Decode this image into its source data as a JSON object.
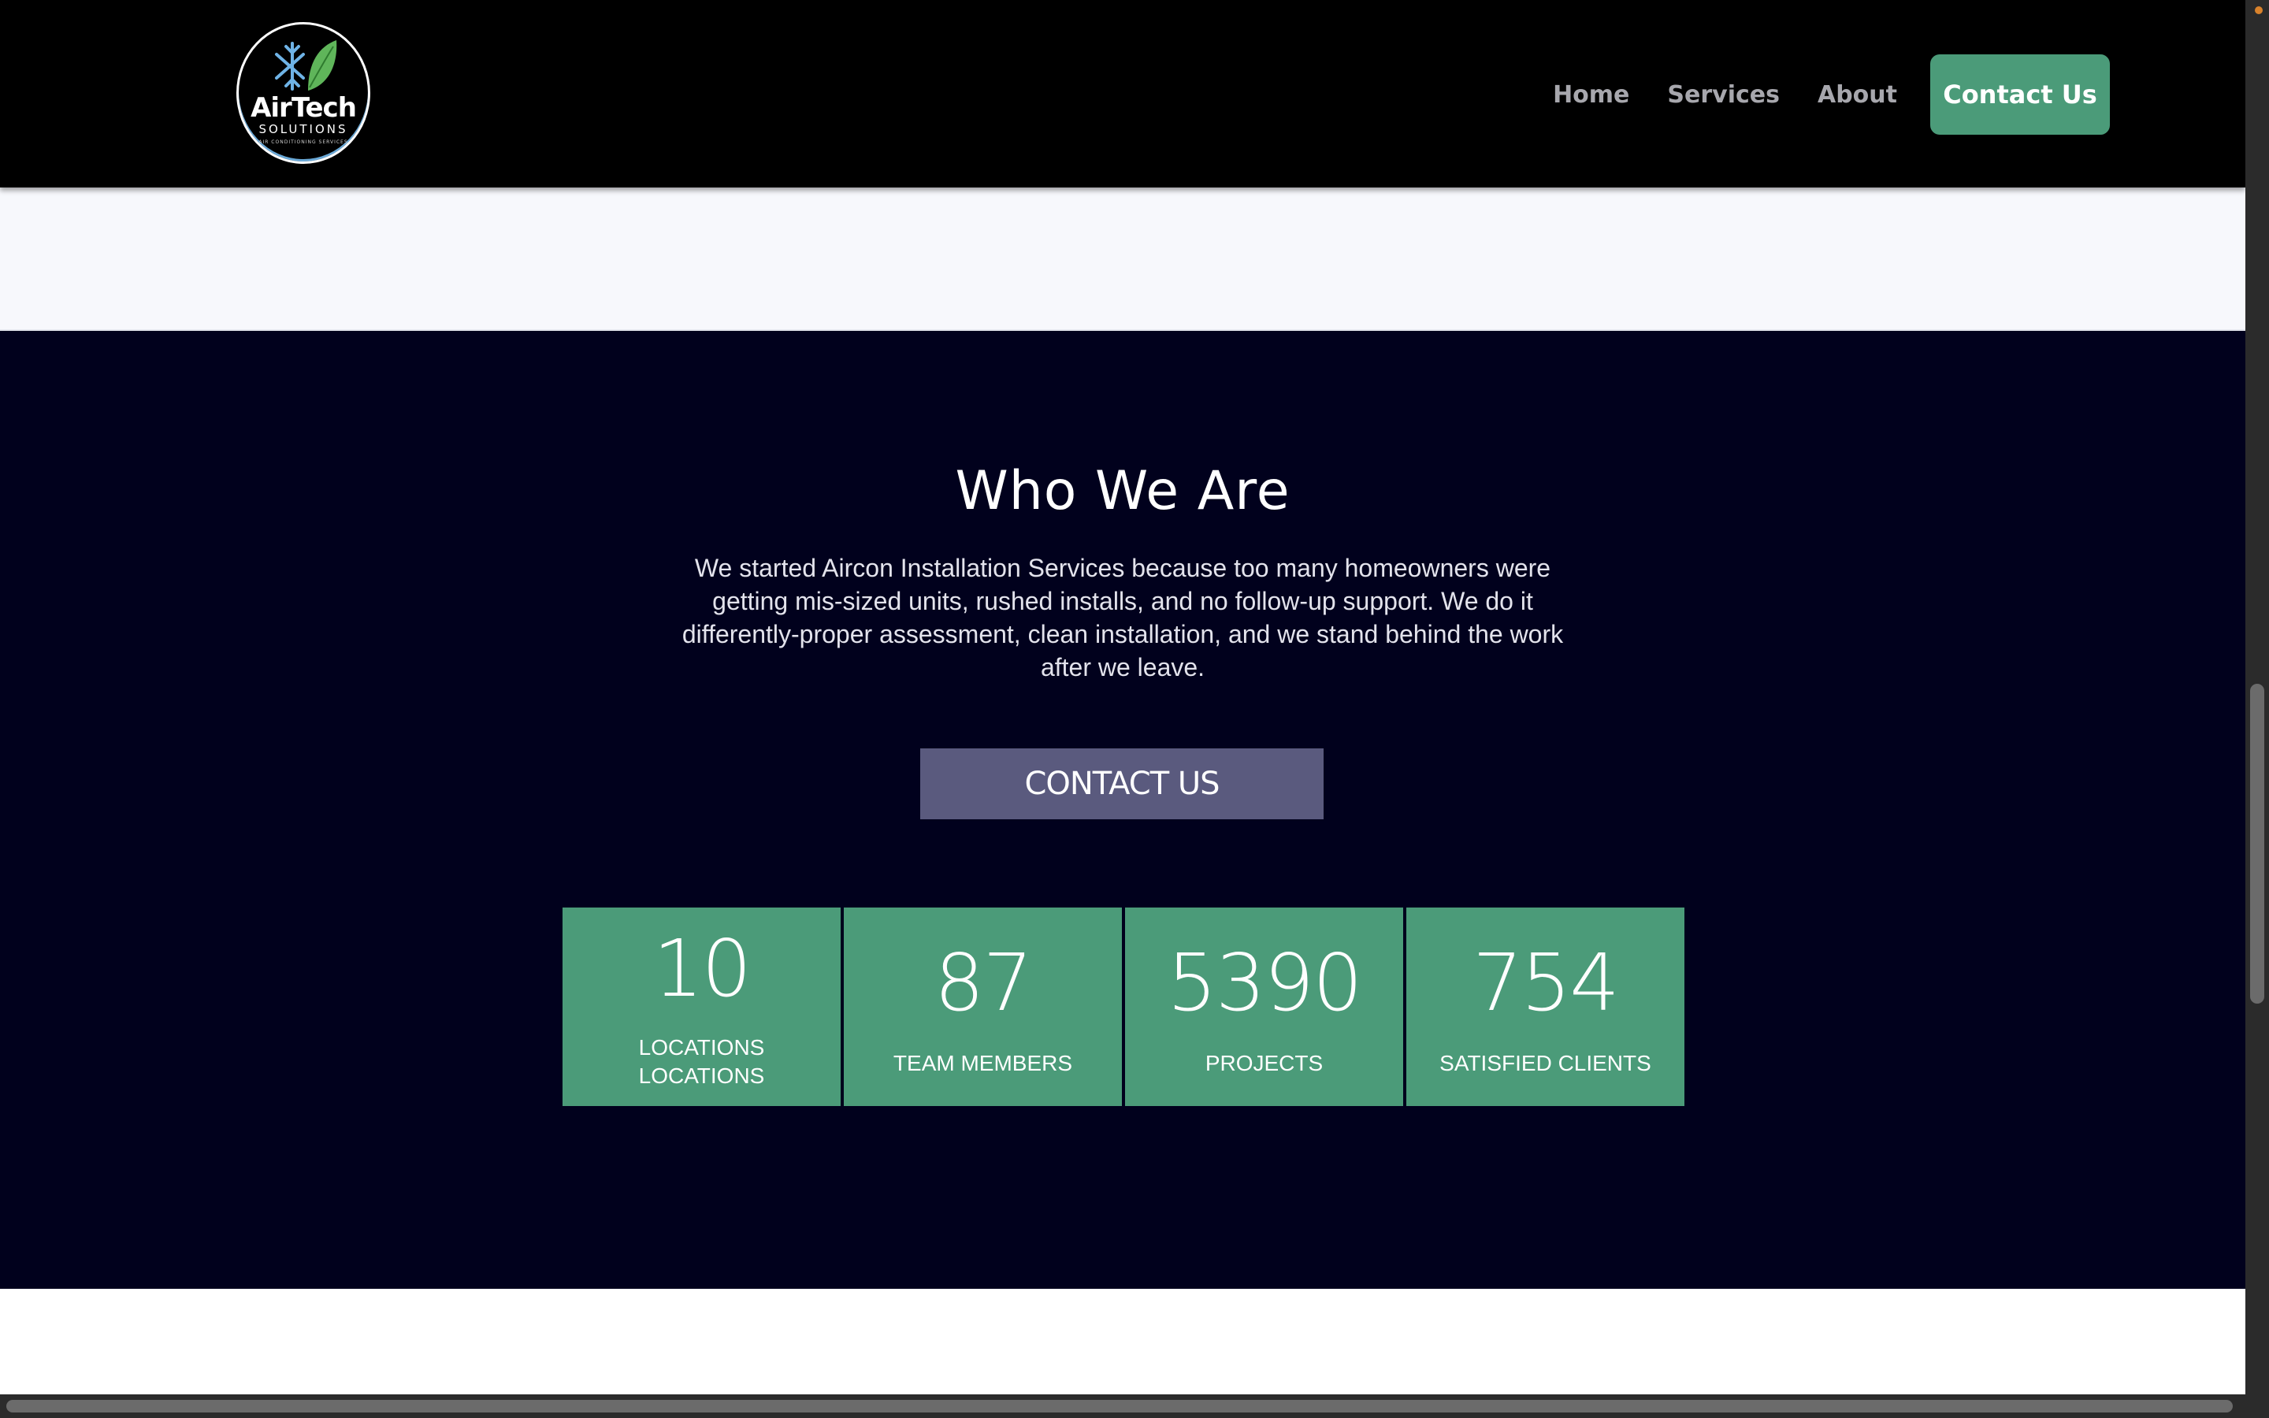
{
  "header": {
    "logo": {
      "name": "AirTech",
      "subtitle": "SOLUTIONS",
      "tagline": "AIR CONDITIONING SERVICES",
      "icons": [
        "snowflake-icon",
        "leaf-icon"
      ]
    },
    "nav": {
      "items": [
        {
          "label": "Home"
        },
        {
          "label": "Services"
        },
        {
          "label": "About"
        }
      ],
      "cta_label": "Contact Us"
    }
  },
  "about": {
    "title": "Who We Are",
    "body": "We started Aircon Installation Services because too many homeowners were getting mis-sized units, rushed installs, and no follow-up support. We do it differently-proper assessment, clean installation, and we stand behind the work after we leave.",
    "button_label": "CONTACT US",
    "stats": [
      {
        "value": "10",
        "label": "LOCATIONS LOCATIONS"
      },
      {
        "value": "87",
        "label": "TEAM MEMBERS"
      },
      {
        "value": "5390",
        "label": "PROJECTS"
      },
      {
        "value": "754",
        "label": "SATISFIED CLIENTS"
      }
    ]
  },
  "colors": {
    "accent_green": "#4b9b79",
    "header_bg": "#000000",
    "section_bg": "#01011d",
    "button_purple": "#5a5a7e",
    "nav_text": "#a7a7ad",
    "strip_bg": "#f7f8fc"
  }
}
